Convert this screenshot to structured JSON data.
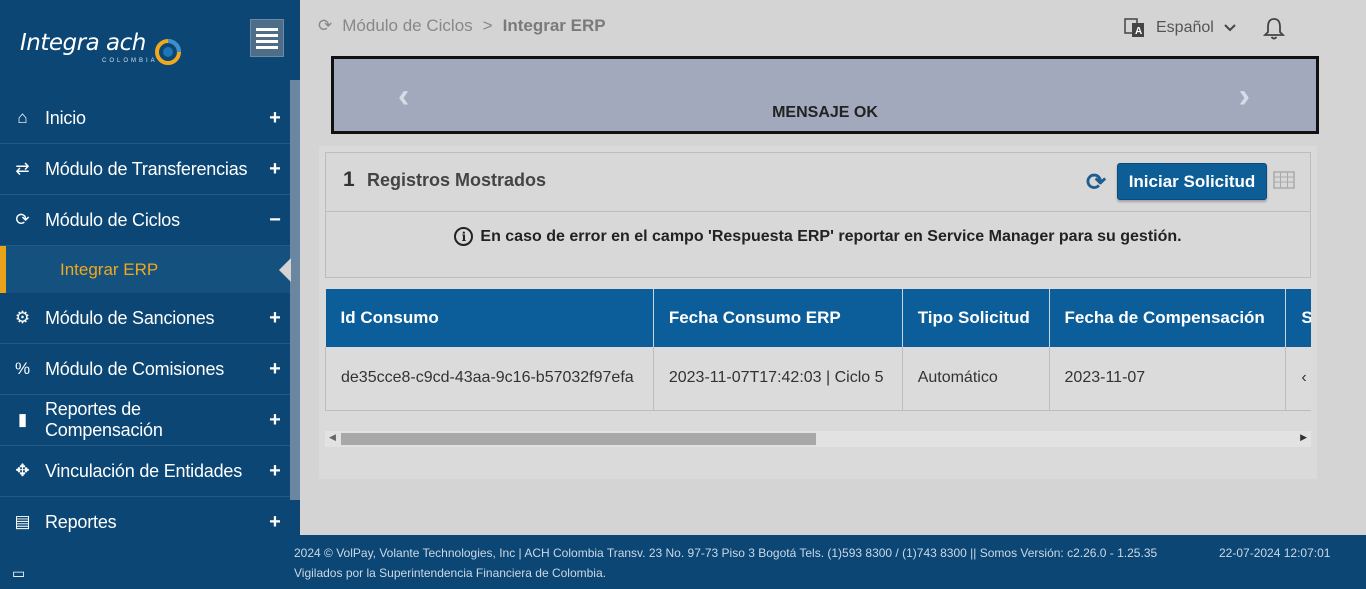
{
  "brand": {
    "name": "Integra ach",
    "sub": "COLOMBIA"
  },
  "sidebar": {
    "items": [
      {
        "label": "Inicio",
        "icon": "home-icon",
        "glyph": "⌂",
        "toggle": "+"
      },
      {
        "label": "Módulo de Transferencias",
        "icon": "exchange-icon",
        "glyph": "⇄",
        "toggle": "+"
      },
      {
        "label": "Módulo de Ciclos",
        "icon": "refresh-icon",
        "glyph": "⟳",
        "toggle": "−"
      },
      {
        "label": "Módulo de Sanciones",
        "icon": "gear-icon",
        "glyph": "⚙",
        "toggle": "+"
      },
      {
        "label": "Módulo de Comisiones",
        "icon": "percent-icon",
        "glyph": "%",
        "toggle": "+"
      },
      {
        "label": "Reportes de Compensación",
        "icon": "file-icon",
        "glyph": "▮",
        "toggle": "+"
      },
      {
        "label": "Vinculación de Entidades",
        "icon": "crosshair-icon",
        "glyph": "✥",
        "toggle": "+"
      },
      {
        "label": "Reportes",
        "icon": "document-icon",
        "glyph": "▤",
        "toggle": "+"
      }
    ],
    "sub_active": "Integrar ERP"
  },
  "breadcrumb": {
    "parent": "Módulo de Ciclos",
    "sep": ">",
    "current": "Integrar ERP"
  },
  "language": {
    "label": "Español"
  },
  "banner": {
    "message": "MENSAJE OK",
    "prev": "‹",
    "next": "›"
  },
  "records": {
    "count": "1",
    "label": "Registros Mostrados"
  },
  "actions": {
    "start_label": "Iniciar Solicitud"
  },
  "notice": "En caso de error en el campo 'Respuesta ERP' reportar en Service Manager para su gestión.",
  "table": {
    "headers": [
      "Id Consumo",
      "Fecha Consumo ERP",
      "Tipo Solicitud",
      "Fecha de Compensación",
      "S"
    ],
    "rows": [
      [
        "de35cce8-c9cd-43aa-9c16-b57032f97efa",
        "2023-11-07T17:42:03 | Ciclo 5",
        "Automático",
        "2023-11-07",
        "‹"
      ]
    ]
  },
  "footer": {
    "line1": "2024 © VolPay, Volante Technologies, Inc | ACH Colombia Transv. 23 No. 97-73 Piso 3 Bogotá Tels. (1)593 8300 / (1)743 8300 || Somos Versión: c2.26.0 - 1.25.35",
    "line2": "Vigilados por la Superintendencia Financiera de Colombia.",
    "datetime": "22-07-2024 12:07:01"
  },
  "colors": {
    "sidebar": "#0b4674",
    "accent": "#f0a81c",
    "primary": "#0d5d97"
  }
}
